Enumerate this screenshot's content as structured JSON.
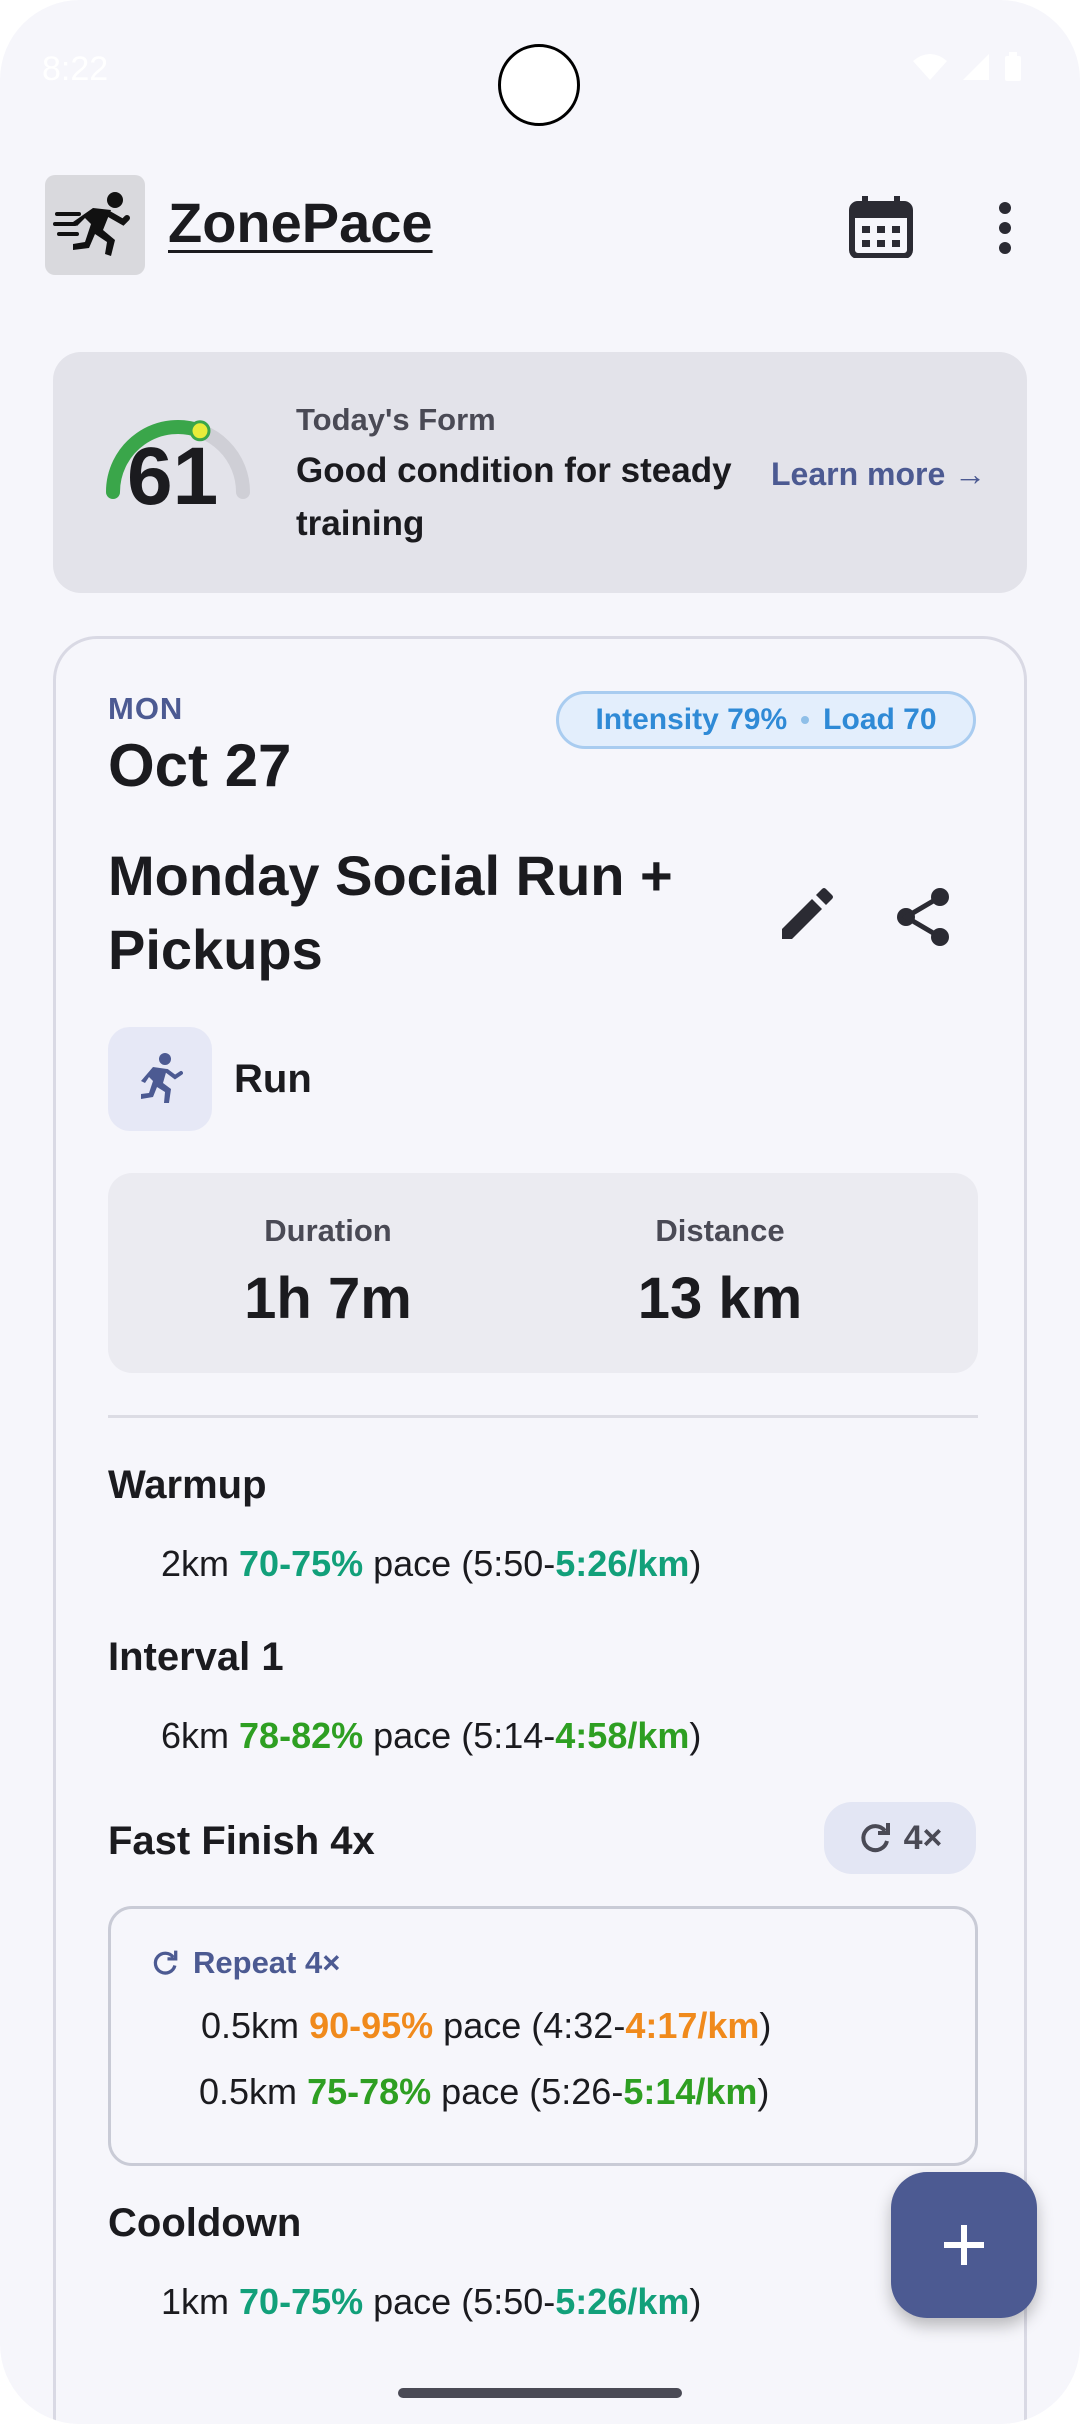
{
  "status_bar": {
    "time": "8:22"
  },
  "app": {
    "title": "ZonePace"
  },
  "form": {
    "score": "61",
    "score_fraction": 0.61,
    "label": "Today's Form",
    "description": "Good condition for steady training",
    "learn_more": "Learn more →"
  },
  "workout": {
    "day": "MON",
    "date": "Oct 27",
    "intensity": "Intensity 79%",
    "load": "Load 70",
    "title": "Monday Social Run + Pickups",
    "type": "Run",
    "duration_label": "Duration",
    "duration_value": "1h 7m",
    "distance_label": "Distance",
    "distance_value": "13 km"
  },
  "sections": {
    "warmup": {
      "title": "Warmup",
      "dist": "2km",
      "pct": "70-75%",
      "pace_word": "pace",
      "open": "(5:50-",
      "pace": "5:26/km",
      "close": ")"
    },
    "interval": {
      "title": "Interval 1",
      "dist": "6km",
      "pct": "78-82%",
      "pace_word": "pace",
      "open": "(5:14-",
      "pace": "4:58/km",
      "close": ")"
    },
    "fast_finish": {
      "title": "Fast Finish 4x",
      "repeat_chip": "4×",
      "repeat_label": "Repeat 4×",
      "steps": [
        {
          "dist": "0.5km",
          "pct": "90-95%",
          "pace_word": "pace",
          "open": "(4:32-",
          "pace": "4:17/km",
          "close": ")"
        },
        {
          "dist": "0.5km",
          "pct": "75-78%",
          "pace_word": "pace",
          "open": "(5:26-",
          "pace": "5:14/km",
          "close": ")"
        }
      ]
    },
    "cooldown": {
      "title": "Cooldown",
      "dist": "1km",
      "pct": "70-75%",
      "pace_word": "pace",
      "open": "(5:50-",
      "pace": "5:26/km",
      "close": ")"
    }
  },
  "icons": {
    "logo": "running-person-icon",
    "calendar": "calendar-icon",
    "more": "more-vert-icon",
    "edit": "pencil-icon",
    "share": "share-icon",
    "type": "run-icon",
    "repeat": "repeat-icon",
    "add": "plus-icon"
  },
  "colors": {
    "accent": "#4c5a92",
    "teal": "#12a07a",
    "green": "#2e9f22",
    "orange": "#f08a1c",
    "chip_blue": "#2f8ad6"
  }
}
